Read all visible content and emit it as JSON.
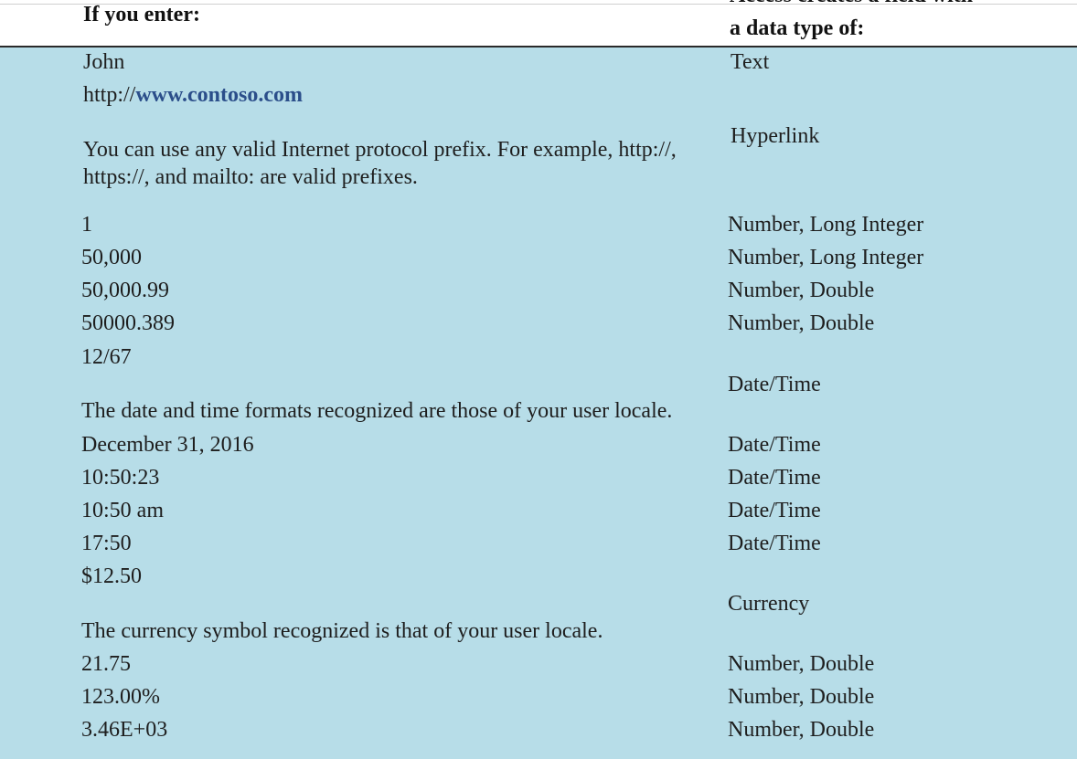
{
  "table": {
    "header": {
      "col1": "If you enter:",
      "col2_line1": "Access creates a field with",
      "col2_line2": "a data type of:"
    },
    "rows": {
      "r0": {
        "input": "John",
        "type": "Text"
      },
      "r1": {
        "input_prefix": "http://",
        "input_link": "www.contoso.com",
        "note_line1": "You can use any valid Internet protocol prefix. For example, http://,",
        "note_line2": "https://, and mailto: are valid prefixes.",
        "type": "Hyperlink"
      },
      "r2": {
        "input": "1",
        "type": "Number, Long Integer"
      },
      "r3": {
        "input": "50,000",
        "type": "Number, Long Integer"
      },
      "r4": {
        "input": "50,000.99",
        "type": "Number, Double"
      },
      "r5": {
        "input": "50000.389",
        "type": "Number, Double"
      },
      "r6": {
        "input": "12/67",
        "note": "The date and time formats recognized are those of your user locale.",
        "type": "Date/Time"
      },
      "r7": {
        "input": "December 31, 2016",
        "type": "Date/Time"
      },
      "r8": {
        "input": "10:50:23",
        "type": "Date/Time"
      },
      "r9": {
        "input": "10:50 am",
        "type": "Date/Time"
      },
      "r10": {
        "input": "17:50",
        "type": "Date/Time"
      },
      "r11": {
        "input": "$12.50",
        "note": "The currency symbol recognized is that of your user locale.",
        "type": "Currency"
      },
      "r12": {
        "input": "21.75",
        "type": "Number, Double"
      },
      "r13": {
        "input": "123.00%",
        "type": "Number, Double"
      },
      "r14": {
        "input": "3.46E+03",
        "type": "Number, Double"
      }
    }
  }
}
